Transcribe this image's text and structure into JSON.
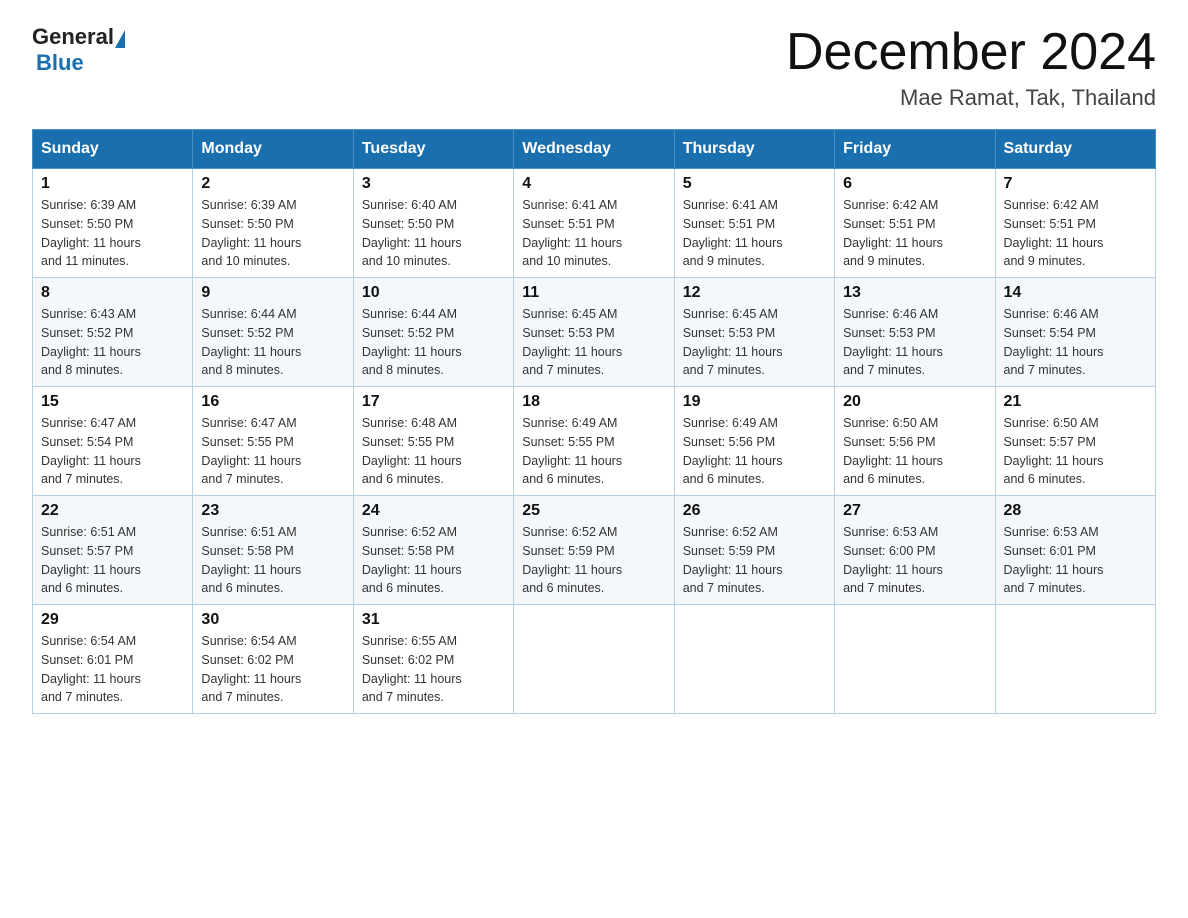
{
  "logo": {
    "general": "General",
    "blue": "Blue"
  },
  "title": "December 2024",
  "subtitle": "Mae Ramat, Tak, Thailand",
  "days_header": [
    "Sunday",
    "Monday",
    "Tuesday",
    "Wednesday",
    "Thursday",
    "Friday",
    "Saturday"
  ],
  "weeks": [
    [
      {
        "day": "1",
        "sunrise": "6:39 AM",
        "sunset": "5:50 PM",
        "daylight": "11 hours and 11 minutes."
      },
      {
        "day": "2",
        "sunrise": "6:39 AM",
        "sunset": "5:50 PM",
        "daylight": "11 hours and 10 minutes."
      },
      {
        "day": "3",
        "sunrise": "6:40 AM",
        "sunset": "5:50 PM",
        "daylight": "11 hours and 10 minutes."
      },
      {
        "day": "4",
        "sunrise": "6:41 AM",
        "sunset": "5:51 PM",
        "daylight": "11 hours and 10 minutes."
      },
      {
        "day": "5",
        "sunrise": "6:41 AM",
        "sunset": "5:51 PM",
        "daylight": "11 hours and 9 minutes."
      },
      {
        "day": "6",
        "sunrise": "6:42 AM",
        "sunset": "5:51 PM",
        "daylight": "11 hours and 9 minutes."
      },
      {
        "day": "7",
        "sunrise": "6:42 AM",
        "sunset": "5:51 PM",
        "daylight": "11 hours and 9 minutes."
      }
    ],
    [
      {
        "day": "8",
        "sunrise": "6:43 AM",
        "sunset": "5:52 PM",
        "daylight": "11 hours and 8 minutes."
      },
      {
        "day": "9",
        "sunrise": "6:44 AM",
        "sunset": "5:52 PM",
        "daylight": "11 hours and 8 minutes."
      },
      {
        "day": "10",
        "sunrise": "6:44 AM",
        "sunset": "5:52 PM",
        "daylight": "11 hours and 8 minutes."
      },
      {
        "day": "11",
        "sunrise": "6:45 AM",
        "sunset": "5:53 PM",
        "daylight": "11 hours and 7 minutes."
      },
      {
        "day": "12",
        "sunrise": "6:45 AM",
        "sunset": "5:53 PM",
        "daylight": "11 hours and 7 minutes."
      },
      {
        "day": "13",
        "sunrise": "6:46 AM",
        "sunset": "5:53 PM",
        "daylight": "11 hours and 7 minutes."
      },
      {
        "day": "14",
        "sunrise": "6:46 AM",
        "sunset": "5:54 PM",
        "daylight": "11 hours and 7 minutes."
      }
    ],
    [
      {
        "day": "15",
        "sunrise": "6:47 AM",
        "sunset": "5:54 PM",
        "daylight": "11 hours and 7 minutes."
      },
      {
        "day": "16",
        "sunrise": "6:47 AM",
        "sunset": "5:55 PM",
        "daylight": "11 hours and 7 minutes."
      },
      {
        "day": "17",
        "sunrise": "6:48 AM",
        "sunset": "5:55 PM",
        "daylight": "11 hours and 6 minutes."
      },
      {
        "day": "18",
        "sunrise": "6:49 AM",
        "sunset": "5:55 PM",
        "daylight": "11 hours and 6 minutes."
      },
      {
        "day": "19",
        "sunrise": "6:49 AM",
        "sunset": "5:56 PM",
        "daylight": "11 hours and 6 minutes."
      },
      {
        "day": "20",
        "sunrise": "6:50 AM",
        "sunset": "5:56 PM",
        "daylight": "11 hours and 6 minutes."
      },
      {
        "day": "21",
        "sunrise": "6:50 AM",
        "sunset": "5:57 PM",
        "daylight": "11 hours and 6 minutes."
      }
    ],
    [
      {
        "day": "22",
        "sunrise": "6:51 AM",
        "sunset": "5:57 PM",
        "daylight": "11 hours and 6 minutes."
      },
      {
        "day": "23",
        "sunrise": "6:51 AM",
        "sunset": "5:58 PM",
        "daylight": "11 hours and 6 minutes."
      },
      {
        "day": "24",
        "sunrise": "6:52 AM",
        "sunset": "5:58 PM",
        "daylight": "11 hours and 6 minutes."
      },
      {
        "day": "25",
        "sunrise": "6:52 AM",
        "sunset": "5:59 PM",
        "daylight": "11 hours and 6 minutes."
      },
      {
        "day": "26",
        "sunrise": "6:52 AM",
        "sunset": "5:59 PM",
        "daylight": "11 hours and 7 minutes."
      },
      {
        "day": "27",
        "sunrise": "6:53 AM",
        "sunset": "6:00 PM",
        "daylight": "11 hours and 7 minutes."
      },
      {
        "day": "28",
        "sunrise": "6:53 AM",
        "sunset": "6:01 PM",
        "daylight": "11 hours and 7 minutes."
      }
    ],
    [
      {
        "day": "29",
        "sunrise": "6:54 AM",
        "sunset": "6:01 PM",
        "daylight": "11 hours and 7 minutes."
      },
      {
        "day": "30",
        "sunrise": "6:54 AM",
        "sunset": "6:02 PM",
        "daylight": "11 hours and 7 minutes."
      },
      {
        "day": "31",
        "sunrise": "6:55 AM",
        "sunset": "6:02 PM",
        "daylight": "11 hours and 7 minutes."
      },
      null,
      null,
      null,
      null
    ]
  ],
  "labels": {
    "sunrise": "Sunrise:",
    "sunset": "Sunset:",
    "daylight": "Daylight:"
  }
}
